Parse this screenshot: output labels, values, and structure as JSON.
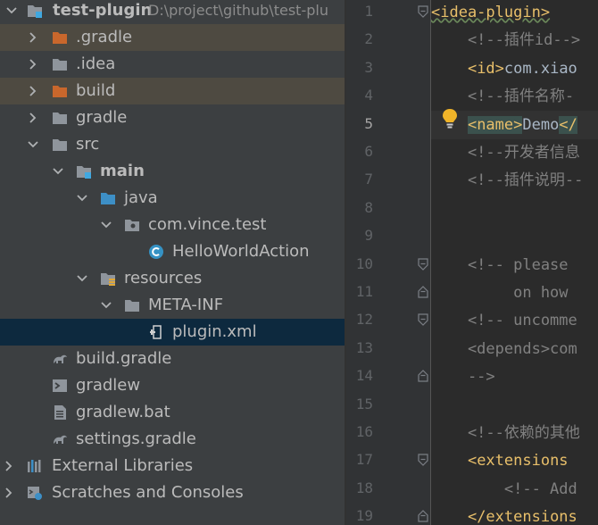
{
  "project_tree": {
    "root": {
      "name": "test-plugin",
      "path": "D:\\project\\github\\test-plu"
    },
    "items": [
      {
        "name": ".gradle",
        "icon": "folder-orange-icon"
      },
      {
        "name": ".idea",
        "icon": "folder-icon"
      },
      {
        "name": "build",
        "icon": "folder-orange-icon"
      },
      {
        "name": "gradle",
        "icon": "folder-icon"
      },
      {
        "name": "src",
        "icon": "folder-icon"
      },
      {
        "name": "main",
        "icon": "module-folder-icon"
      },
      {
        "name": "java",
        "icon": "source-folder-icon"
      },
      {
        "name": "com.vince.test",
        "icon": "package-icon"
      },
      {
        "name": "HelloWorldAction",
        "icon": "class-icon"
      },
      {
        "name": "resources",
        "icon": "resources-folder-icon"
      },
      {
        "name": "META-INF",
        "icon": "folder-icon"
      },
      {
        "name": "plugin.xml",
        "icon": "plugin-xml-icon"
      },
      {
        "name": "build.gradle",
        "icon": "gradle-icon"
      },
      {
        "name": "gradlew",
        "icon": "shell-script-icon"
      },
      {
        "name": "gradlew.bat",
        "icon": "text-file-icon"
      },
      {
        "name": "settings.gradle",
        "icon": "gradle-icon"
      },
      {
        "name": "External Libraries",
        "icon": "libraries-icon"
      },
      {
        "name": "Scratches and Consoles",
        "icon": "scratches-icon"
      }
    ]
  },
  "editor": {
    "current_line": "5",
    "lines": [
      {
        "num": "1",
        "parts": [
          {
            "text": "<idea-plugin>",
            "c": "tag wavy"
          }
        ]
      },
      {
        "num": "2",
        "parts": [
          {
            "text": "    <!--插件id-->",
            "c": "cmt"
          }
        ]
      },
      {
        "num": "3",
        "parts": [
          {
            "text": "    ",
            "c": "txt"
          },
          {
            "text": "<id>",
            "c": "tag"
          },
          {
            "text": "com.xiao",
            "c": "txt"
          }
        ]
      },
      {
        "num": "4",
        "parts": [
          {
            "text": "    <!--插件名称-",
            "c": "cmt"
          }
        ]
      },
      {
        "num": "5",
        "parts": [
          {
            "text": "    ",
            "c": "txt"
          },
          {
            "text": "<name>",
            "c": "tag matched"
          },
          {
            "text": "Demo",
            "c": "txt"
          },
          {
            "text": "</",
            "c": "tag matched"
          }
        ]
      },
      {
        "num": "6",
        "parts": [
          {
            "text": "    <!--开发者信息",
            "c": "cmt"
          }
        ]
      },
      {
        "num": "7",
        "parts": [
          {
            "text": "    <!--插件说明--",
            "c": "cmt"
          }
        ]
      },
      {
        "num": "8",
        "parts": []
      },
      {
        "num": "9",
        "parts": []
      },
      {
        "num": "10",
        "parts": [
          {
            "text": "    <!-- please",
            "c": "cmt"
          }
        ]
      },
      {
        "num": "11",
        "parts": [
          {
            "text": "         on how",
            "c": "cmt"
          }
        ]
      },
      {
        "num": "12",
        "parts": [
          {
            "text": "    <!-- uncomme",
            "c": "cmt"
          }
        ]
      },
      {
        "num": "13",
        "parts": [
          {
            "text": "    <depends>com",
            "c": "cmt"
          }
        ]
      },
      {
        "num": "14",
        "parts": [
          {
            "text": "    -->",
            "c": "cmt"
          }
        ]
      },
      {
        "num": "15",
        "parts": []
      },
      {
        "num": "16",
        "parts": [
          {
            "text": "    <!--依赖的其他",
            "c": "cmt"
          }
        ]
      },
      {
        "num": "17",
        "parts": [
          {
            "text": "    ",
            "c": "txt"
          },
          {
            "text": "<extensions",
            "c": "tag"
          }
        ]
      },
      {
        "num": "18",
        "parts": [
          {
            "text": "        <!-- Add",
            "c": "cmt"
          }
        ]
      },
      {
        "num": "19",
        "parts": [
          {
            "text": "    ",
            "c": "txt"
          },
          {
            "text": "</extensions",
            "c": "tag"
          }
        ]
      }
    ],
    "intention_icon": "lightbulb-icon"
  },
  "colors": {
    "tree_bg": "#3c3f41",
    "editor_bg": "#2b2b2b",
    "selection": "#0d293e",
    "excluded_highlight": "#4e4a41",
    "tag": "#e8bf6a",
    "comment": "#808080"
  }
}
